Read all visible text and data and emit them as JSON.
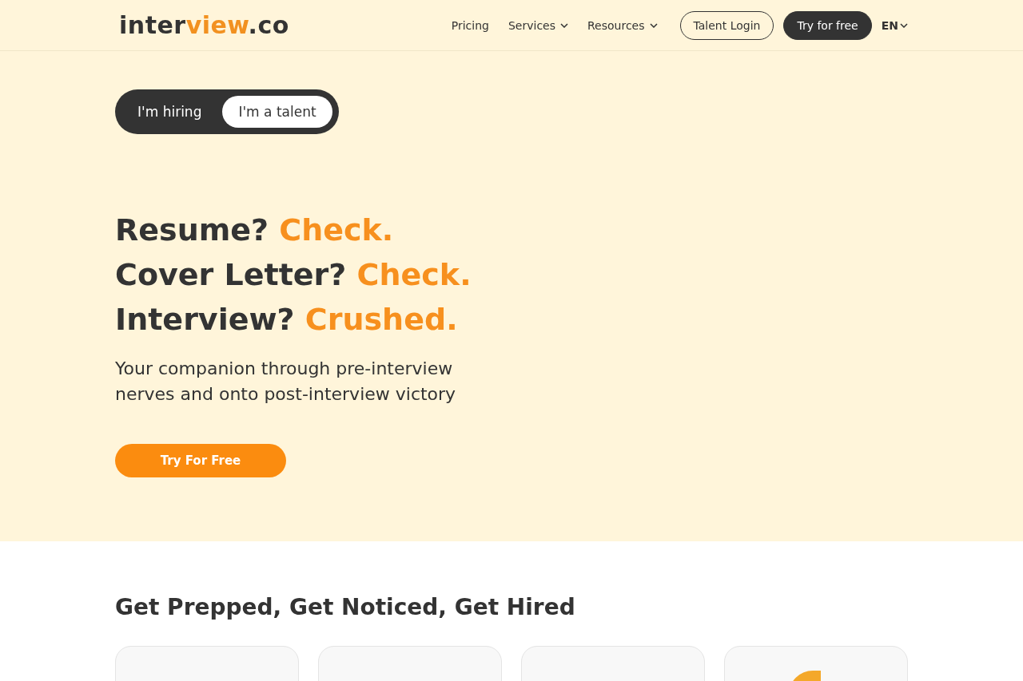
{
  "header": {
    "logo": [
      {
        "text": "inter",
        "kind": "plain"
      },
      {
        "text": "view",
        "kind": "accent"
      },
      {
        "text": ".co",
        "kind": "plain"
      }
    ],
    "nav": [
      {
        "label": "Pricing",
        "dropdown": false
      },
      {
        "label": "Services",
        "dropdown": true
      },
      {
        "label": "Resources",
        "dropdown": true
      }
    ],
    "login_button": "Talent Login",
    "try_button": "Try for free",
    "language": "EN"
  },
  "hero": {
    "toggle": [
      {
        "label": "I'm hiring",
        "selected": false
      },
      {
        "label": "I'm a talent",
        "selected": true
      }
    ],
    "headline": [
      [
        {
          "text": "Resume?",
          "kind": "plain"
        },
        {
          "text": "Check.",
          "kind": "accent"
        }
      ],
      [
        {
          "text": "Cover Letter?",
          "kind": "plain"
        },
        {
          "text": "Check.",
          "kind": "accent"
        }
      ],
      [
        {
          "text": "Interview?",
          "kind": "plain"
        },
        {
          "text": "Crushed.",
          "kind": "accent"
        }
      ]
    ],
    "subtitle": "Your companion through pre-interview nerves and onto post-interview victory",
    "cta": "Try For Free"
  },
  "features": {
    "title": "Get Prepped, Get Noticed, Get Hired",
    "cards": [
      {
        "icon_visible": false
      },
      {
        "icon_visible": false
      },
      {
        "icon_visible": false
      },
      {
        "icon_visible": true
      }
    ]
  }
}
